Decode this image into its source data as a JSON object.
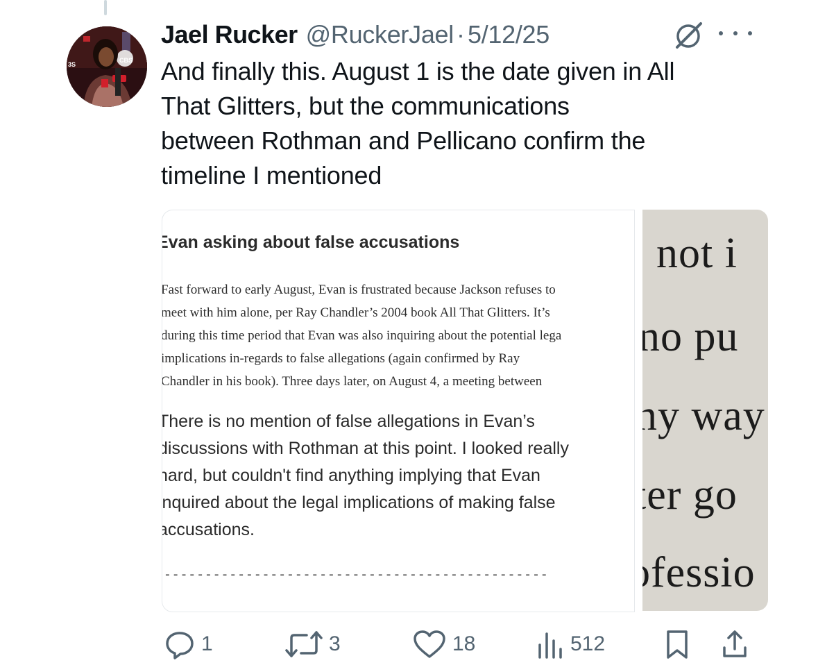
{
  "tweet": {
    "author_name": "Jael Rucker",
    "handle": "@RuckerJael",
    "separator": "·",
    "date": "5/12/25",
    "text_lines": [
      "And finally this. August 1 is the date given in All",
      "That Glitters, but the communications",
      "between Rothman and Pellicano confirm the",
      "timeline I mentioned"
    ]
  },
  "avatar": {
    "badge_text": "CBS",
    "edge_text": "3S"
  },
  "media": {
    "left_image": {
      "heading": "Evan asking about false accusations",
      "paragraph_lines": [
        "Fast forward to early August, Evan is frustrated because Jackson refuses to",
        "meet with him alone, per Ray Chandler’s 2004 book All That Glitters. It’s",
        "during this time period that Evan was also inquiring about the potential lega",
        "implications in-regards to false allegations (again confirmed by Ray",
        "Chandler in his book). Three days later, on August 4, a meeting between"
      ],
      "body_lines": [
        "There is no mention of false allegations in Evan’s",
        "discussions with Rothman at this point. I looked really",
        "hard, but couldn't find anything implying that Evan",
        "inquired about the legal implications of making false",
        "accusations."
      ],
      "dash_rule": "-----------------------------------------------"
    },
    "right_image": {
      "lines": [
        "not i",
        "no pu",
        "ny way",
        "ter go",
        "ofessio"
      ]
    }
  },
  "actions": {
    "reply": {
      "icon": "reply-icon",
      "count": "1"
    },
    "repost": {
      "icon": "repost-icon",
      "count": "3"
    },
    "like": {
      "icon": "heart-icon",
      "count": "18"
    },
    "views": {
      "icon": "views-icon",
      "count": "512"
    },
    "bookmark": {
      "icon": "bookmark-icon"
    },
    "share": {
      "icon": "share-icon"
    }
  },
  "colors": {
    "secondary_text": "#536471",
    "primary_text": "#0f1419",
    "border": "#e6e9ec"
  }
}
